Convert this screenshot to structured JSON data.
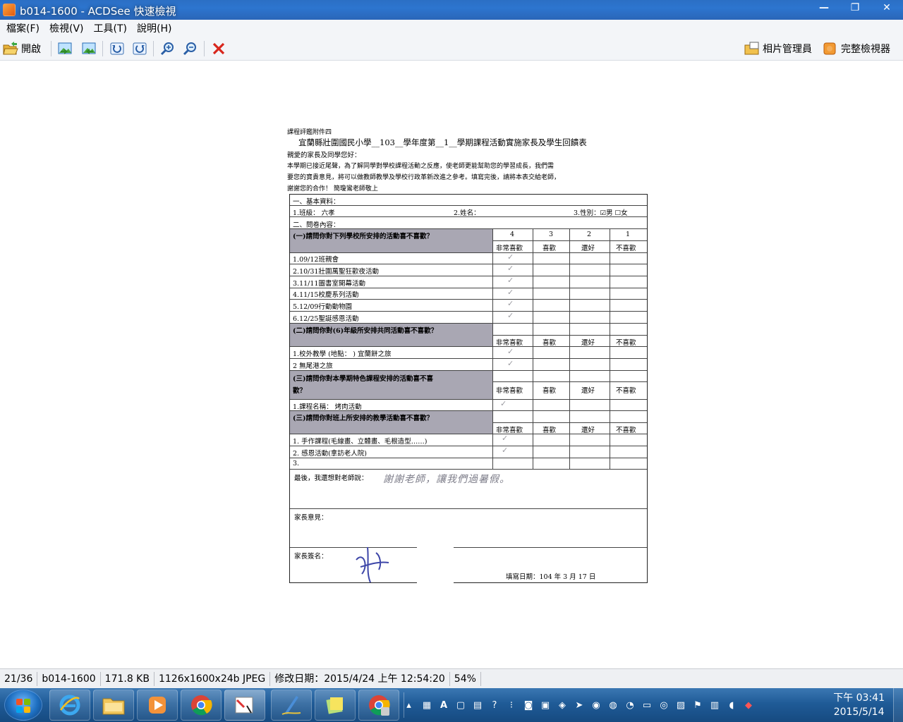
{
  "window": {
    "title": "b014-1600 - ACDSee 快速檢視",
    "minimize": "—",
    "restore": "❐",
    "close": "✕"
  },
  "menu": [
    "檔案(F)",
    "檢視(V)",
    "工具(T)",
    "說明(H)"
  ],
  "toolbar": {
    "open_label": "開啟",
    "photo_manager_label": "相片管理員",
    "full_viewer_label": "完整檢視器"
  },
  "document": {
    "header_note": "課程評鑑附件四",
    "title": "宜蘭縣壯圍國民小學__103__學年度第__1__學期課程活動實施家長及學生回饋表",
    "greeting": "親愛的家長及同學您好：",
    "intro_1": "本學期已接近尾聲，為了解同學對學校課程活動之反應，使老師更能幫助您的學習成長，我們需",
    "intro_2": "要您的寶貴意見，將可以做教師教學及學校行政革新改進之參考。填寫完後，請將本表交給老師，",
    "intro_3": "謝謝您的合作！  簡瓊鸞老師敬上",
    "sec1": "一、基本資料：",
    "class_label": "1.班級：  六孝",
    "name_label": "2.姓名：",
    "gender_label": "3.性別：☑男  ☐女",
    "sec2": "二、問卷內容：",
    "q1": "(一)請問你對下列學校所安排的活動喜不喜歡？",
    "scores": [
      "4",
      "3",
      "2",
      "1"
    ],
    "ratings": [
      "非常喜歡",
      "喜歡",
      "還好",
      "不喜歡"
    ],
    "q1_items": [
      "1.09/12班親會",
      "2.10/31壯圍萬聖狂歡夜活動",
      "3.11/11圖書室開幕活動",
      "4.11/15校慶系列活動",
      "5.12/09行動動物園",
      "6.12/25聖誕感恩活動"
    ],
    "q2": "(二)請問你對(6)年級所安排共同活動喜不喜歡？",
    "q2_items": [
      "1.校外教學 (地點：  )  宜蘭餅之旅",
      "2                          無尾港之旅"
    ],
    "q3_a": "(三)請問你對本學期特色課程安排的活動喜不喜",
    "q3_b": "歡？",
    "q3_items": [
      "1.課程名稱：  烤肉活動"
    ],
    "q4": "(三)請問你對班上所安排的教學活動喜不喜歡？",
    "q4_items": [
      "1.  手作課程(毛線畫、立體畫、毛根造型……)",
      "2.  感恩活動(拿訪老人院)",
      "3."
    ],
    "last_words_label": "最後，我還想對老師說：",
    "last_words_written": "謝謝老師，讓我們過暑假。",
    "parent_opinion_label": "家長意見：",
    "parent_sign_label": "家長簽名：",
    "date_label": "填寫日期：104 年 3 月 17 日"
  },
  "status": {
    "position": "21/36",
    "filename": "b014-1600",
    "size": "171.8 KB",
    "dimensions": "1126x1600x24b JPEG",
    "modified": "修改日期：2015/4/24 上午 12:54:20",
    "zoom": "54%"
  },
  "taskbar": {
    "time": "下午 03:41",
    "date": "2015/5/14"
  }
}
